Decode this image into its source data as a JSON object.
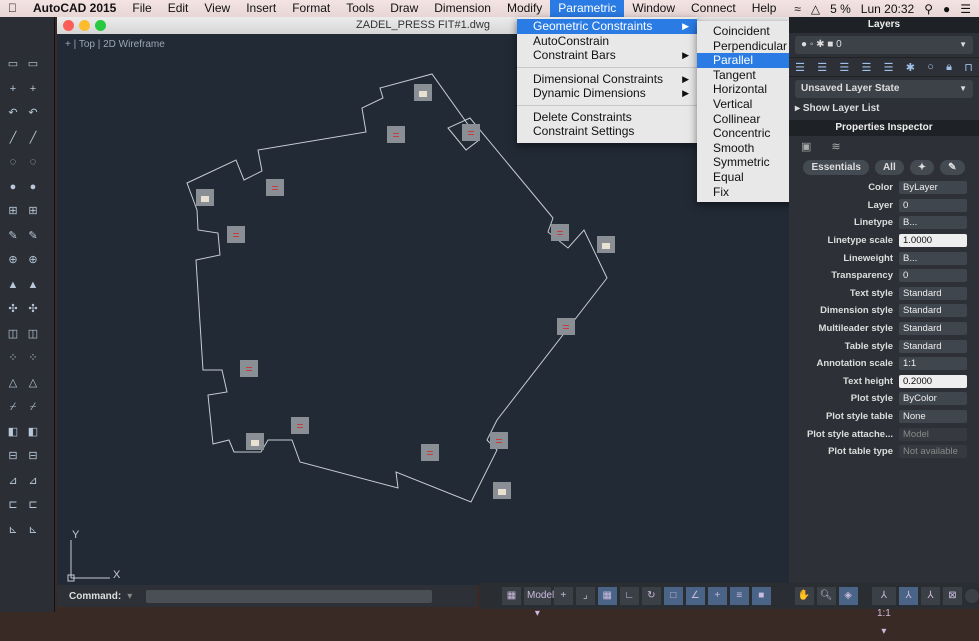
{
  "menubar": {
    "app": "AutoCAD 2015",
    "items": [
      "File",
      "Edit",
      "View",
      "Insert",
      "Format",
      "Tools",
      "Draw",
      "Dimension",
      "Modify",
      "Parametric",
      "Window",
      "Connect",
      "Help"
    ],
    "active": "Parametric",
    "battery": "5 %",
    "clock": "Lun 20:32"
  },
  "document": {
    "title": "ZADEL_PRESS FIT#1.dwg",
    "viewport_label": "+ | Top | 2D Wireframe",
    "ucs_y": "Y",
    "ucs_x": "X"
  },
  "parametric_menu": {
    "items": [
      {
        "label": "Geometric Constraints",
        "submenu": true,
        "selected": true
      },
      {
        "label": "AutoConstrain"
      },
      {
        "label": "Constraint Bars",
        "submenu": true
      },
      {
        "sep": true
      },
      {
        "label": "Dimensional Constraints",
        "submenu": true
      },
      {
        "label": "Dynamic Dimensions",
        "submenu": true
      },
      {
        "sep": true
      },
      {
        "label": "Delete Constraints"
      },
      {
        "label": "Constraint Settings"
      }
    ]
  },
  "geometric_submenu": {
    "items": [
      "Coincident",
      "Perpendicular",
      "Parallel",
      "Tangent",
      "Horizontal",
      "Vertical",
      "Collinear",
      "Concentric",
      "Smooth",
      "Symmetric",
      "Equal",
      "Fix"
    ],
    "selected": "Parallel"
  },
  "layers": {
    "title": "Layers",
    "current": "0",
    "layer_state": "Unsaved Layer State",
    "show_list": "Show Layer List"
  },
  "properties": {
    "title": "Properties Inspector",
    "tabs": [
      "Essentials",
      "All"
    ],
    "rows": [
      {
        "label": "Color",
        "value": "ByLayer"
      },
      {
        "label": "Layer",
        "value": "0"
      },
      {
        "label": "Linetype",
        "value": "B..."
      },
      {
        "label": "Linetype scale",
        "value": "1.0000",
        "white": true
      },
      {
        "label": "Lineweight",
        "value": "B..."
      },
      {
        "label": "Transparency",
        "value": "0"
      },
      {
        "label": "Text style",
        "value": "Standard"
      },
      {
        "label": "Dimension style",
        "value": "Standard"
      },
      {
        "label": "Multileader style",
        "value": "Standard"
      },
      {
        "label": "Table style",
        "value": "Standard"
      },
      {
        "label": "Annotation scale",
        "value": "1:1"
      },
      {
        "label": "Text height",
        "value": "0.2000",
        "white": true
      },
      {
        "label": "Plot style",
        "value": "ByColor"
      },
      {
        "label": "Plot style table",
        "value": "None"
      },
      {
        "label": "Plot style attache...",
        "value": "Model",
        "disabled": true
      },
      {
        "label": "Plot table type",
        "value": "Not available",
        "disabled": true
      }
    ]
  },
  "command": {
    "label": "Command:"
  },
  "status": {
    "model": "Model",
    "scale": "1:1"
  },
  "colors": {
    "accent": "#2a7be4",
    "canvas": "#222a36",
    "geometry": "#c8ccd2",
    "constraint_marker": "#8a8f96",
    "equal_sign": "#d03030"
  }
}
